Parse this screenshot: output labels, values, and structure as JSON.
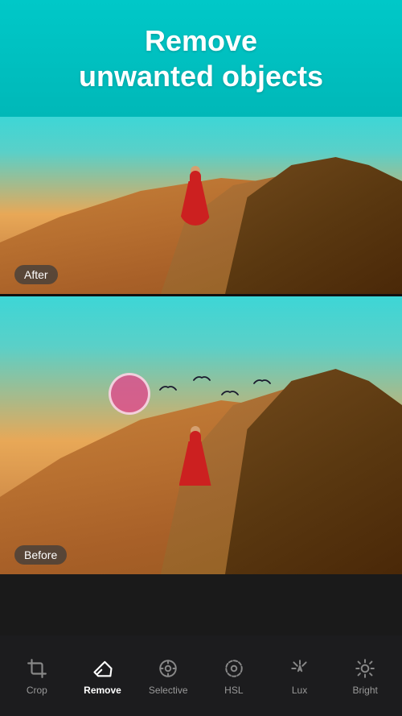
{
  "header": {
    "title_line1": "Remove",
    "title_line2": "unwanted objects",
    "bg_color": "#00c0c0"
  },
  "after_panel": {
    "label": "After"
  },
  "before_panel": {
    "label": "Before"
  },
  "toolbar": {
    "items": [
      {
        "id": "crop",
        "label": "Crop",
        "icon": "crop-icon",
        "active": false
      },
      {
        "id": "remove",
        "label": "Remove",
        "icon": "remove-icon",
        "active": true
      },
      {
        "id": "selective",
        "label": "Selective",
        "icon": "selective-icon",
        "active": false
      },
      {
        "id": "hsl",
        "label": "HSL",
        "icon": "hsl-icon",
        "active": false
      },
      {
        "id": "lux",
        "label": "Lux",
        "icon": "lux-icon",
        "active": false
      },
      {
        "id": "brightness",
        "label": "Bright",
        "icon": "brightness-icon",
        "active": false
      }
    ]
  }
}
